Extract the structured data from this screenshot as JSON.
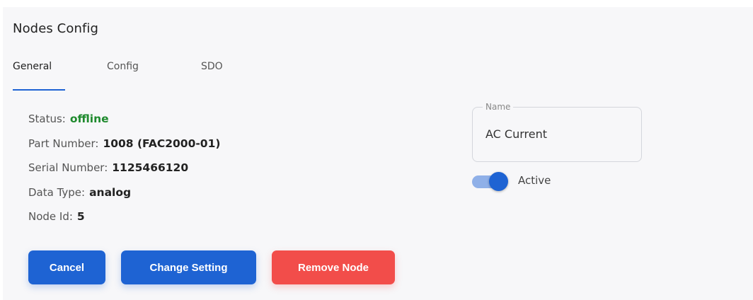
{
  "panel": {
    "title": "Nodes Config"
  },
  "tabs": [
    {
      "label": "General",
      "active": true
    },
    {
      "label": "Config",
      "active": false
    },
    {
      "label": "SDO",
      "active": false
    }
  ],
  "info": {
    "status": {
      "label": "Status:",
      "value": "offline",
      "color": "#1f8a2e"
    },
    "part_number": {
      "label": "Part Number:",
      "value": "1008 (FAC2000-01)"
    },
    "serial_number": {
      "label": "Serial Number:",
      "value": "1125466120"
    },
    "data_type": {
      "label": "Data Type:",
      "value": "analog"
    },
    "node_id": {
      "label": "Node Id:",
      "value": "5"
    }
  },
  "name_field": {
    "legend": "Name",
    "value": "AC Current"
  },
  "active_toggle": {
    "label": "Active",
    "checked": true
  },
  "buttons": {
    "cancel": "Cancel",
    "change_setting": "Change Setting",
    "remove_node": "Remove Node"
  },
  "colors": {
    "primary": "#1e63d3",
    "danger": "#f24d4a",
    "success": "#1f8a2e"
  }
}
